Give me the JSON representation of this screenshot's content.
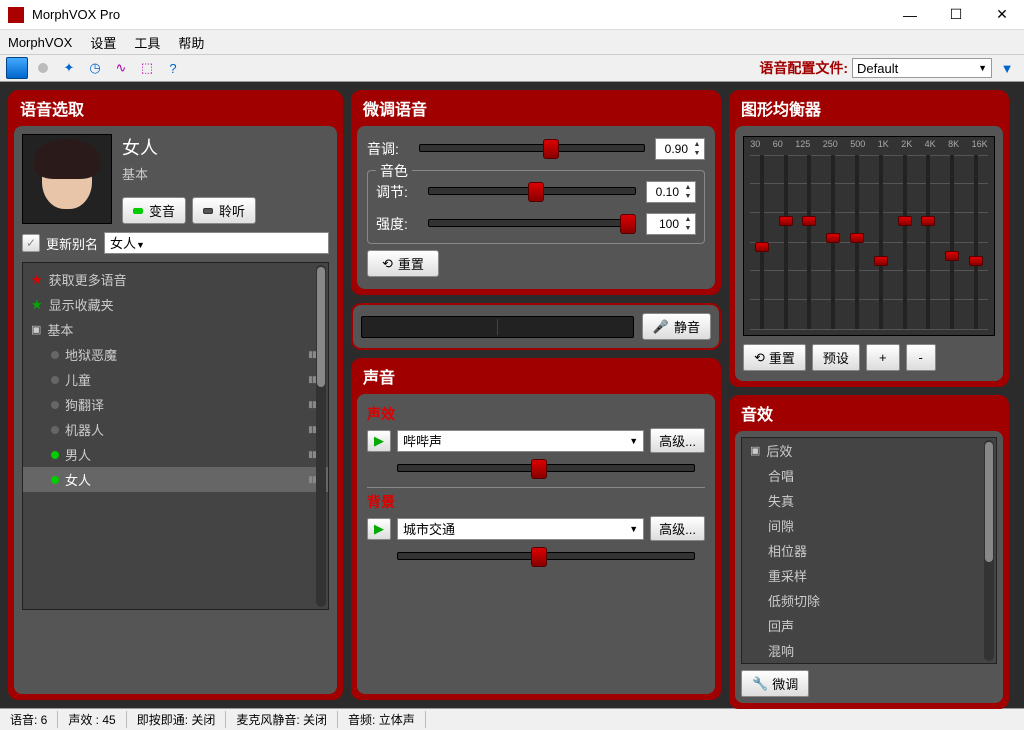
{
  "window": {
    "title": "MorphVOX Pro"
  },
  "menu": {
    "items": [
      "MorphVOX",
      "设置",
      "工具",
      "帮助"
    ]
  },
  "toolbar": {
    "profile_label": "语音配置文件:",
    "profile_value": "Default"
  },
  "voice_panel": {
    "title": "语音选取",
    "name": "女人",
    "category": "基本",
    "btn_morph": "变音",
    "btn_listen": "聆听",
    "alias_label": "更新别名",
    "alias_value": "女人",
    "more_voices": "获取更多语音",
    "show_fav": "显示收藏夹",
    "group": "基本",
    "items": [
      "地狱恶魔",
      "儿童",
      "狗翻译",
      "机器人",
      "男人",
      "女人"
    ]
  },
  "tweak": {
    "title": "微调语音",
    "pitch_label": "音调:",
    "pitch_value": "0.90",
    "timbre_title": "音色",
    "shift_label": "调节:",
    "shift_value": "0.10",
    "strength_label": "强度:",
    "strength_value": "100",
    "reset": "重置"
  },
  "level": {
    "mute": "静音"
  },
  "sound": {
    "title": "声音",
    "fx_title": "声效",
    "fx_value": "哔哔声",
    "bg_title": "背景",
    "bg_value": "城市交通",
    "advanced": "高级..."
  },
  "eq": {
    "title": "图形均衡器",
    "bands": [
      "30",
      "60",
      "125",
      "250",
      "500",
      "1K",
      "2K",
      "4K",
      "8K",
      "16K"
    ],
    "positions": [
      50,
      35,
      35,
      45,
      45,
      58,
      35,
      35,
      55,
      58
    ],
    "reset": "重置",
    "preset": "预设",
    "plus": "+",
    "minus": "-"
  },
  "fx": {
    "title": "音效",
    "group": "后效",
    "items": [
      "合唱",
      "失真",
      "间隙",
      "相位器",
      "重采样",
      "低频切除",
      "回声",
      "混响"
    ],
    "finetune": "微调"
  },
  "status": {
    "voice": "语音: 6",
    "sfx": "声效 : 45",
    "ptt": "即按即通: 关闭",
    "mic": "麦克风静音: 关闭",
    "audio": "音频: 立体声"
  }
}
